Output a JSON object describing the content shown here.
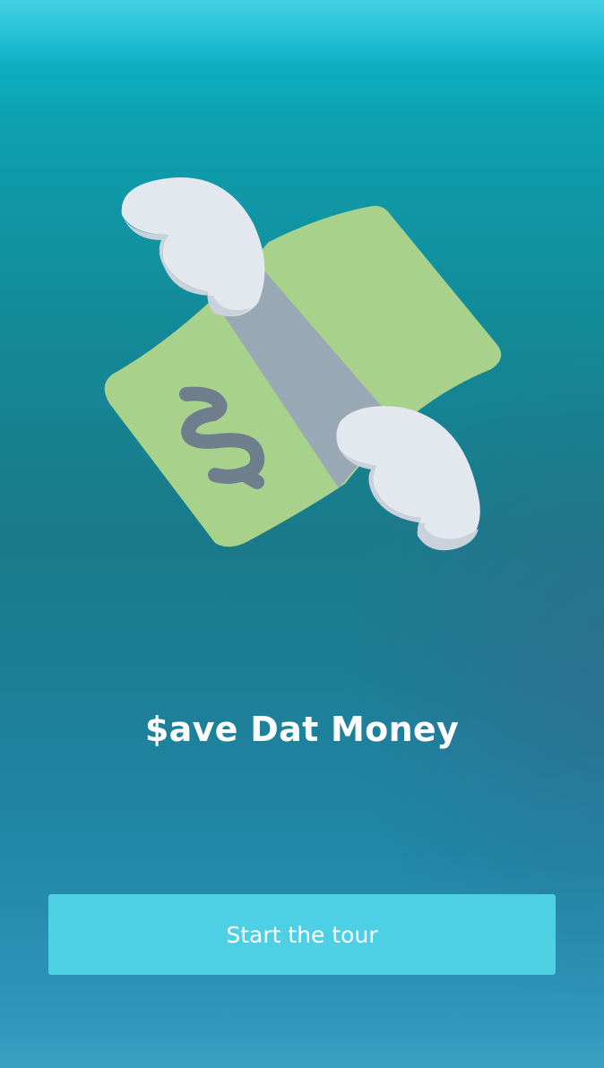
{
  "onboarding": {
    "title": "$ave Dat Money",
    "cta_label": "Start the tour",
    "illustration_icon": "flying-money-icon"
  },
  "colors": {
    "bill_green": "#a8d28c",
    "band_gray": "#98a8b4",
    "dollar_sign": "#6e7e8c",
    "wing_white": "#e3e8ef",
    "wing_shadow": "#c9d1db",
    "button": "#4ed0e4"
  }
}
